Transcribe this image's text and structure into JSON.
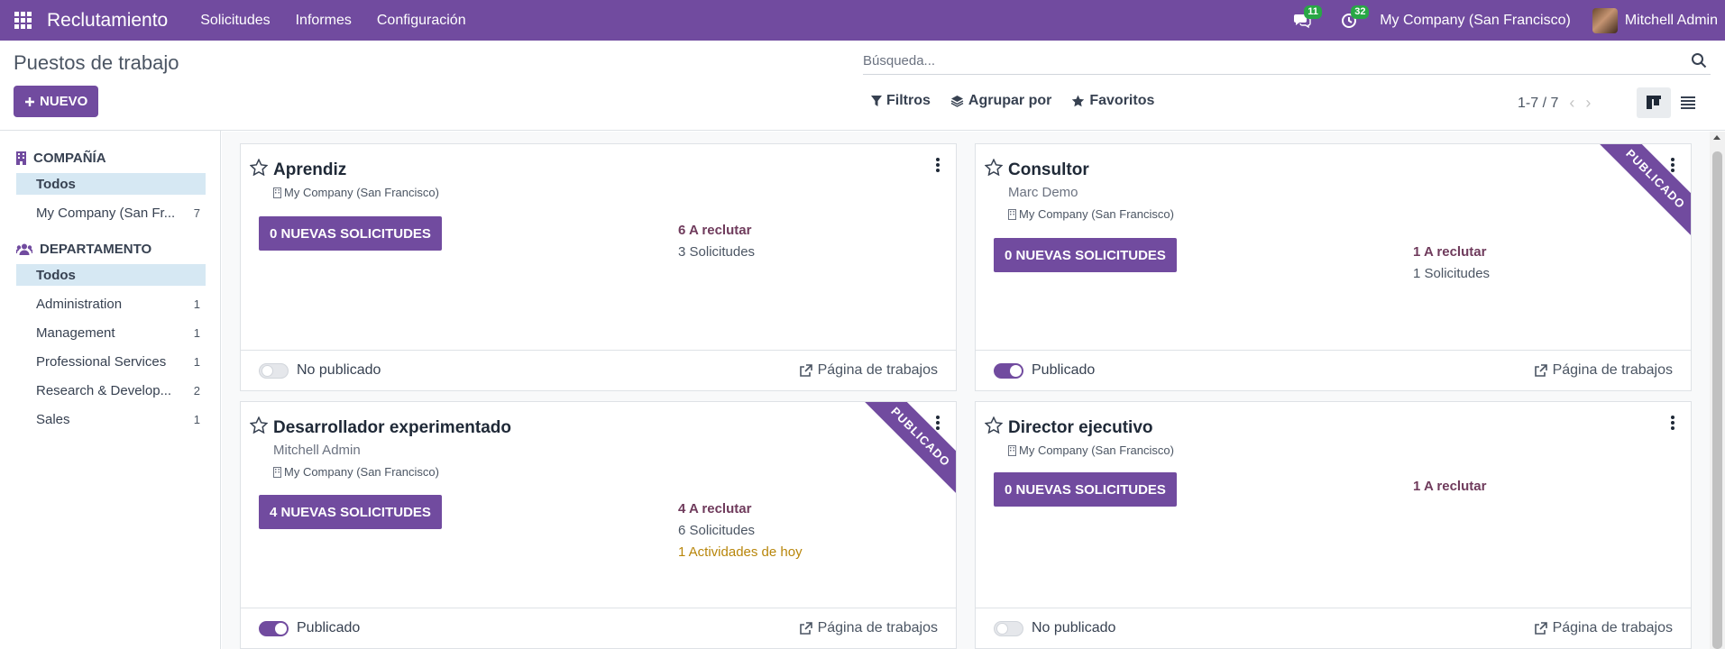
{
  "navbar": {
    "app_title": "Reclutamiento",
    "menu": [
      "Solicitudes",
      "Informes",
      "Configuración"
    ],
    "messages_count": "11",
    "activities_count": "32",
    "company": "My Company (San Francisco)",
    "user": "Mitchell Admin"
  },
  "control_panel": {
    "title": "Puestos de trabajo",
    "new_button": "NUEVO",
    "search_placeholder": "Búsqueda...",
    "filters": "Filtros",
    "group_by": "Agrupar por",
    "favorites": "Favoritos",
    "pager": "1-7 / 7"
  },
  "sidebar": {
    "company_header": "COMPAÑÍA",
    "company_items": [
      {
        "label": "Todos",
        "count": ""
      },
      {
        "label": "My Company (San Fr...",
        "count": "7"
      }
    ],
    "department_header": "DEPARTAMENTO",
    "department_items": [
      {
        "label": "Todos",
        "count": ""
      },
      {
        "label": "Administration",
        "count": "1"
      },
      {
        "label": "Management",
        "count": "1"
      },
      {
        "label": "Professional Services",
        "count": "1"
      },
      {
        "label": "Research & Develop...",
        "count": "2"
      },
      {
        "label": "Sales",
        "count": "1"
      }
    ]
  },
  "jobs": [
    {
      "title": "Aprendiz",
      "company": "My Company (San Francisco)",
      "new_apps": "0 NUEVAS SOLICITUDES",
      "to_recruit": "6 A reclutar",
      "applications": "3 Solicitudes",
      "status": "No publicado",
      "link": "Página de trabajos"
    },
    {
      "title": "Consultor",
      "responsible": "Marc Demo",
      "company": "My Company (San Francisco)",
      "new_apps": "0 NUEVAS SOLICITUDES",
      "to_recruit": "1 A reclutar",
      "applications": "1 Solicitudes",
      "status": "Publicado",
      "ribbon": "PUBLICADO",
      "link": "Página de trabajos"
    },
    {
      "title": "Desarrollador experimentado",
      "responsible": "Mitchell Admin",
      "company": "My Company (San Francisco)",
      "new_apps": "4 NUEVAS SOLICITUDES",
      "to_recruit": "4 A reclutar",
      "applications": "6 Solicitudes",
      "activities": "1 Actividades de hoy",
      "status": "Publicado",
      "ribbon": "PUBLICADO",
      "link": "Página de trabajos"
    },
    {
      "title": "Director ejecutivo",
      "company": "My Company (San Francisco)",
      "new_apps": "0 NUEVAS SOLICITUDES",
      "to_recruit": "1 A reclutar",
      "status": "No publicado",
      "link": "Página de trabajos"
    }
  ],
  "colors": {
    "brand": "#714B9F",
    "recruit_text": "#6f3b5c",
    "activity_text": "#b8860b",
    "active_filter_bg": "#d6e8f3"
  }
}
